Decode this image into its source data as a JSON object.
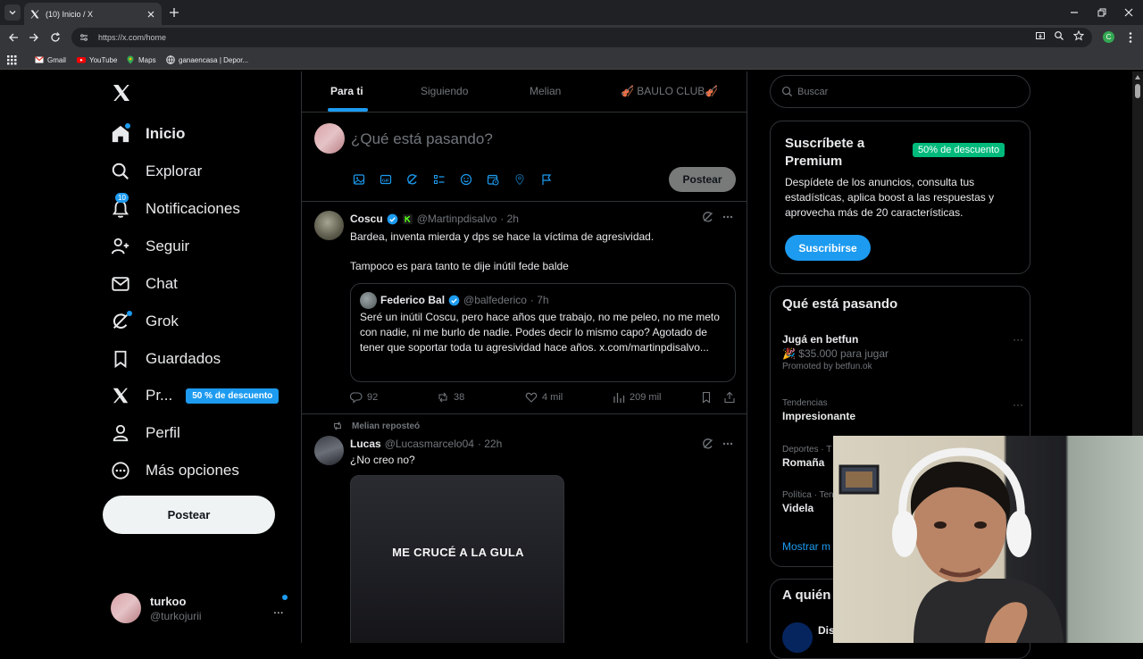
{
  "browser": {
    "tab_title": "(10) Inicio / X",
    "url": "https://x.com/home",
    "profile_initial": "C",
    "bookmarks": [
      "Gmail",
      "YouTube",
      "Maps",
      "ganaencasa | Depor..."
    ]
  },
  "nav": {
    "items": [
      {
        "label": "Inicio",
        "icon": "home-icon"
      },
      {
        "label": "Explorar",
        "icon": "search-icon"
      },
      {
        "label": "Notificaciones",
        "icon": "bell-icon",
        "badge": "10"
      },
      {
        "label": "Seguir",
        "icon": "follow-icon"
      },
      {
        "label": "Chat",
        "icon": "mail-icon"
      },
      {
        "label": "Grok",
        "icon": "grok-icon"
      },
      {
        "label": "Guardados",
        "icon": "bookmark-icon"
      },
      {
        "label": "Pr...",
        "icon": "x-icon",
        "pill": "50 % de descuento"
      },
      {
        "label": "Perfil",
        "icon": "person-icon"
      },
      {
        "label": "Más opciones",
        "icon": "more-circle-icon"
      }
    ],
    "post_button": "Postear",
    "user": {
      "name": "turkoo",
      "handle": "@turkojurii",
      "more": "..."
    }
  },
  "feed": {
    "tabs": [
      "Para ti",
      "Siguiendo",
      "Melian",
      "🎻 BAULO CLUB🎻"
    ],
    "composer": {
      "placeholder": "¿Qué está pasando?",
      "post_label": "Postear"
    },
    "tweet1": {
      "name": "Coscu",
      "handle": "@Martinpdisalvo",
      "time": "· 2h",
      "text1": "Bardea, inventa mierda y dps se hace la víctima de agresividad.",
      "text2": "Tampoco es para tanto te dije inútil fede balde",
      "quote": {
        "name": "Federico Bal",
        "handle": "@balfederico",
        "time": "· 7h",
        "text": "Seré un inútil Coscu, pero hace años que trabajo, no me peleo, no me meto con nadie, ni me burlo de nadie. Podes decir lo mismo capo? Agotado de tener que soportar toda tu agresividad hace años. x.com/martinpdisalvo..."
      },
      "replies": "92",
      "reposts": "38",
      "likes": "4 mil",
      "views": "209 mil"
    },
    "tweet2": {
      "repost_label": "Melian reposteó",
      "name": "Lucas",
      "handle": "@Lucasmarcelo04",
      "time": "· 22h",
      "text": "¿No creo no?",
      "media_caption": "ME CRUCÉ A LA GULA"
    }
  },
  "right": {
    "search_placeholder": "Buscar",
    "premium": {
      "title": "Suscríbete a Premium",
      "badge": "50% de descuento",
      "body": "Despídete de los anuncios, consulta tus estadísticas, aplica boost a las respuestas y aprovecha más de 20 características.",
      "button": "Suscribirse"
    },
    "trends": {
      "title": "Qué está pasando",
      "items": [
        {
          "meta": "",
          "name": "Jugá en betfun",
          "sub": "🎉 $35.000 para jugar",
          "promo": "Promoted by betfun.ok"
        },
        {
          "meta": "Tendencias",
          "name": "Impresionante"
        },
        {
          "meta": "Deportes · T",
          "name": "Romaña"
        },
        {
          "meta": "Política · Ten",
          "name": "Videla"
        }
      ],
      "show_more": "Mostrar m"
    },
    "who": {
      "title": "A quién",
      "first_name": "Dis"
    }
  },
  "colors": {
    "accent": "#1d9bf0",
    "background": "#000000",
    "border": "#2f3336",
    "muted": "#71767b",
    "green_badge": "#00ba7c"
  }
}
